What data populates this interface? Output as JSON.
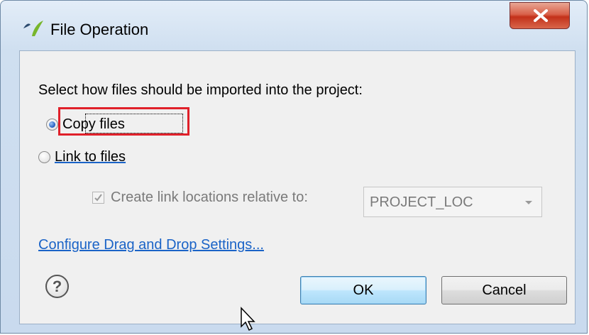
{
  "window": {
    "title": "File Operation",
    "close_icon": "close-icon"
  },
  "dialog": {
    "prompt": "Select how files should be imported into the project:",
    "options": [
      {
        "label": "Copy files",
        "selected": true
      },
      {
        "label": "Link to files",
        "selected": false
      }
    ],
    "relative_checkbox": {
      "label": "Create link locations relative to:",
      "checked": true,
      "enabled": false
    },
    "relative_combo": {
      "value": "PROJECT_LOC",
      "enabled": false
    },
    "settings_link": "Configure Drag and Drop Settings...",
    "buttons": {
      "ok": "OK",
      "cancel": "Cancel"
    }
  },
  "colors": {
    "highlight": "#e0202a",
    "link": "#1a63c7",
    "close_button": "#c3311a"
  }
}
